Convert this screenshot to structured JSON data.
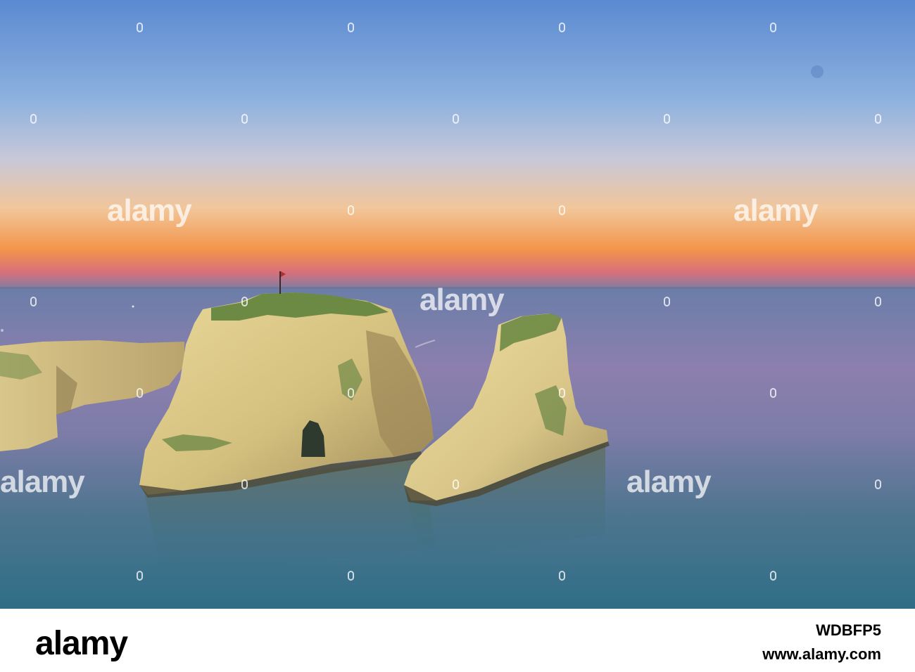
{
  "watermark": {
    "brand": "alamy"
  },
  "footer": {
    "logo": "alamy",
    "image_id": "WDBFP5",
    "url": "www.alamy.com"
  },
  "colors": {
    "sky_top": "#5b8fd2",
    "sunset_orange": "#f39a4a",
    "sea": "#4e6f8f",
    "rock": "#d8c88a"
  }
}
